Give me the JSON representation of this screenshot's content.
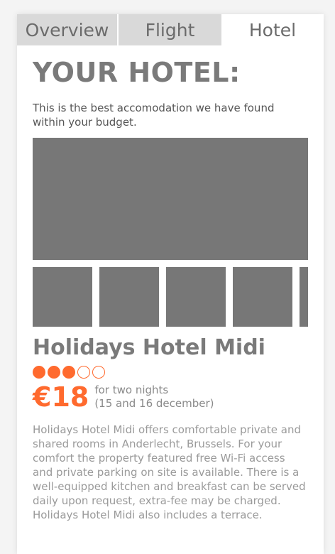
{
  "tabs": [
    {
      "label": "Overview"
    },
    {
      "label": "Flight"
    },
    {
      "label": "Hotel",
      "active": true
    }
  ],
  "header": {
    "title": "YOUR HOTEL:",
    "intro": "This is the best accomodation we have found within your budget."
  },
  "hotel": {
    "name": "Holidays Hotel Midi",
    "rating": {
      "filled": 3,
      "total": 5
    },
    "price": "€18",
    "price_note_line1": "for two nights",
    "price_note_line2": "(15 and 16 december)",
    "description": "Holidays Hotel Midi offers comfortable private and shared rooms in Anderlecht, Brussels. For your comfort the property featured free Wi-Fi access and private parking on site is available. There is a well-equipped kitchen and breakfast can be served daily upon request, extra-fee may be charged. Holidays Hotel Midi also includes a terrace."
  },
  "colors": {
    "accent": "#ff6a2e",
    "placeholder": "#777777",
    "tab_inactive": "#d9d9d9"
  }
}
